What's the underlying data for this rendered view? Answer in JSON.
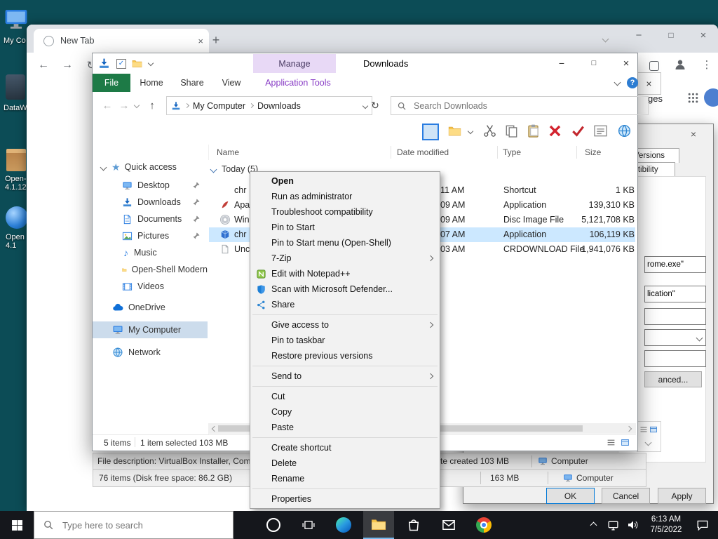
{
  "desktop": {
    "icons": [
      {
        "label": "My Co"
      },
      {
        "label": "DataW"
      },
      {
        "label": "Open-",
        "label2": "4.1.12"
      },
      {
        "label": "Open",
        "label2": "4.1"
      }
    ]
  },
  "chrome": {
    "tab_title": "New Tab",
    "page_link_fragment": "ges"
  },
  "explorer": {
    "title": "Downloads",
    "manage_label": "Manage",
    "tabs": {
      "file": "File",
      "home": "Home",
      "share": "Share",
      "view": "View",
      "app_tools": "Application Tools"
    },
    "breadcrumb": {
      "root": "My Computer",
      "current": "Downloads"
    },
    "search_placeholder": "Search Downloads",
    "columns": {
      "name": "Name",
      "date": "Date modified",
      "type": "Type",
      "size": "Size"
    },
    "group_label": "Today (5)",
    "files": [
      {
        "name": "chr",
        "time": "11 AM",
        "type": "Shortcut",
        "size": "1 KB"
      },
      {
        "name": "Apa",
        "time": "09 AM",
        "type": "Application",
        "size": "139,310 KB"
      },
      {
        "name": "Win",
        "time": "09 AM",
        "type": "Disc Image File",
        "size": "5,121,708 KB"
      },
      {
        "name": "chr",
        "time": "07 AM",
        "type": "Application",
        "size": "106,119 KB"
      },
      {
        "name": "Unc",
        "time": "03 AM",
        "type": "CRDOWNLOAD File",
        "size": "1,941,076 KB"
      }
    ],
    "sidebar": {
      "quick_access": "Quick access",
      "desktop": "Desktop",
      "downloads": "Downloads",
      "documents": "Documents",
      "pictures": "Pictures",
      "music": "Music",
      "open_shell": "Open-Shell Modern",
      "videos": "Videos",
      "onedrive": "OneDrive",
      "my_computer": "My Computer",
      "network": "Network"
    },
    "status": {
      "items": "5 items",
      "selected": "1 item selected 103 MB"
    }
  },
  "context_menu": {
    "items": [
      {
        "label": "Open"
      },
      {
        "label": "Run as administrator"
      },
      {
        "label": "Troubleshoot compatibility"
      },
      {
        "label": "Pin to Start"
      },
      {
        "label": "Pin to Start menu (Open-Shell)"
      },
      {
        "label": "7-Zip"
      },
      {
        "label": "Edit with Notepad++"
      },
      {
        "label": "Scan with Microsoft Defender..."
      },
      {
        "label": "Share"
      },
      {
        "label": "Give access to"
      },
      {
        "label": "Pin to taskbar"
      },
      {
        "label": "Restore previous versions"
      },
      {
        "label": "Send to"
      },
      {
        "label": "Cut"
      },
      {
        "label": "Copy"
      },
      {
        "label": "Paste"
      },
      {
        "label": "Create shortcut"
      },
      {
        "label": "Delete"
      },
      {
        "label": "Rename"
      },
      {
        "label": "Properties"
      }
    ]
  },
  "back_window": {
    "row1_left": "File description: VirtualBox Installer, Com",
    "row1_mid": "te created 103 MB",
    "row1_right": "Computer",
    "row2_left": "76 items (Disk free space: 86.2 GB)",
    "row2_mid": "163 MB",
    "row2_right": "Computer"
  },
  "dialog": {
    "tab_fragment_1": "Versions",
    "tab_fragment_2": "atibility",
    "field_fragment_1": "rome.exe\"",
    "field_fragment_2": "lication\"",
    "advanced_fragment": "anced...",
    "ok": "OK",
    "cancel": "Cancel",
    "apply": "Apply"
  },
  "taskbar": {
    "search_placeholder": "Type here to search",
    "clock_time": "6:13 AM",
    "clock_date": "7/5/2022"
  }
}
